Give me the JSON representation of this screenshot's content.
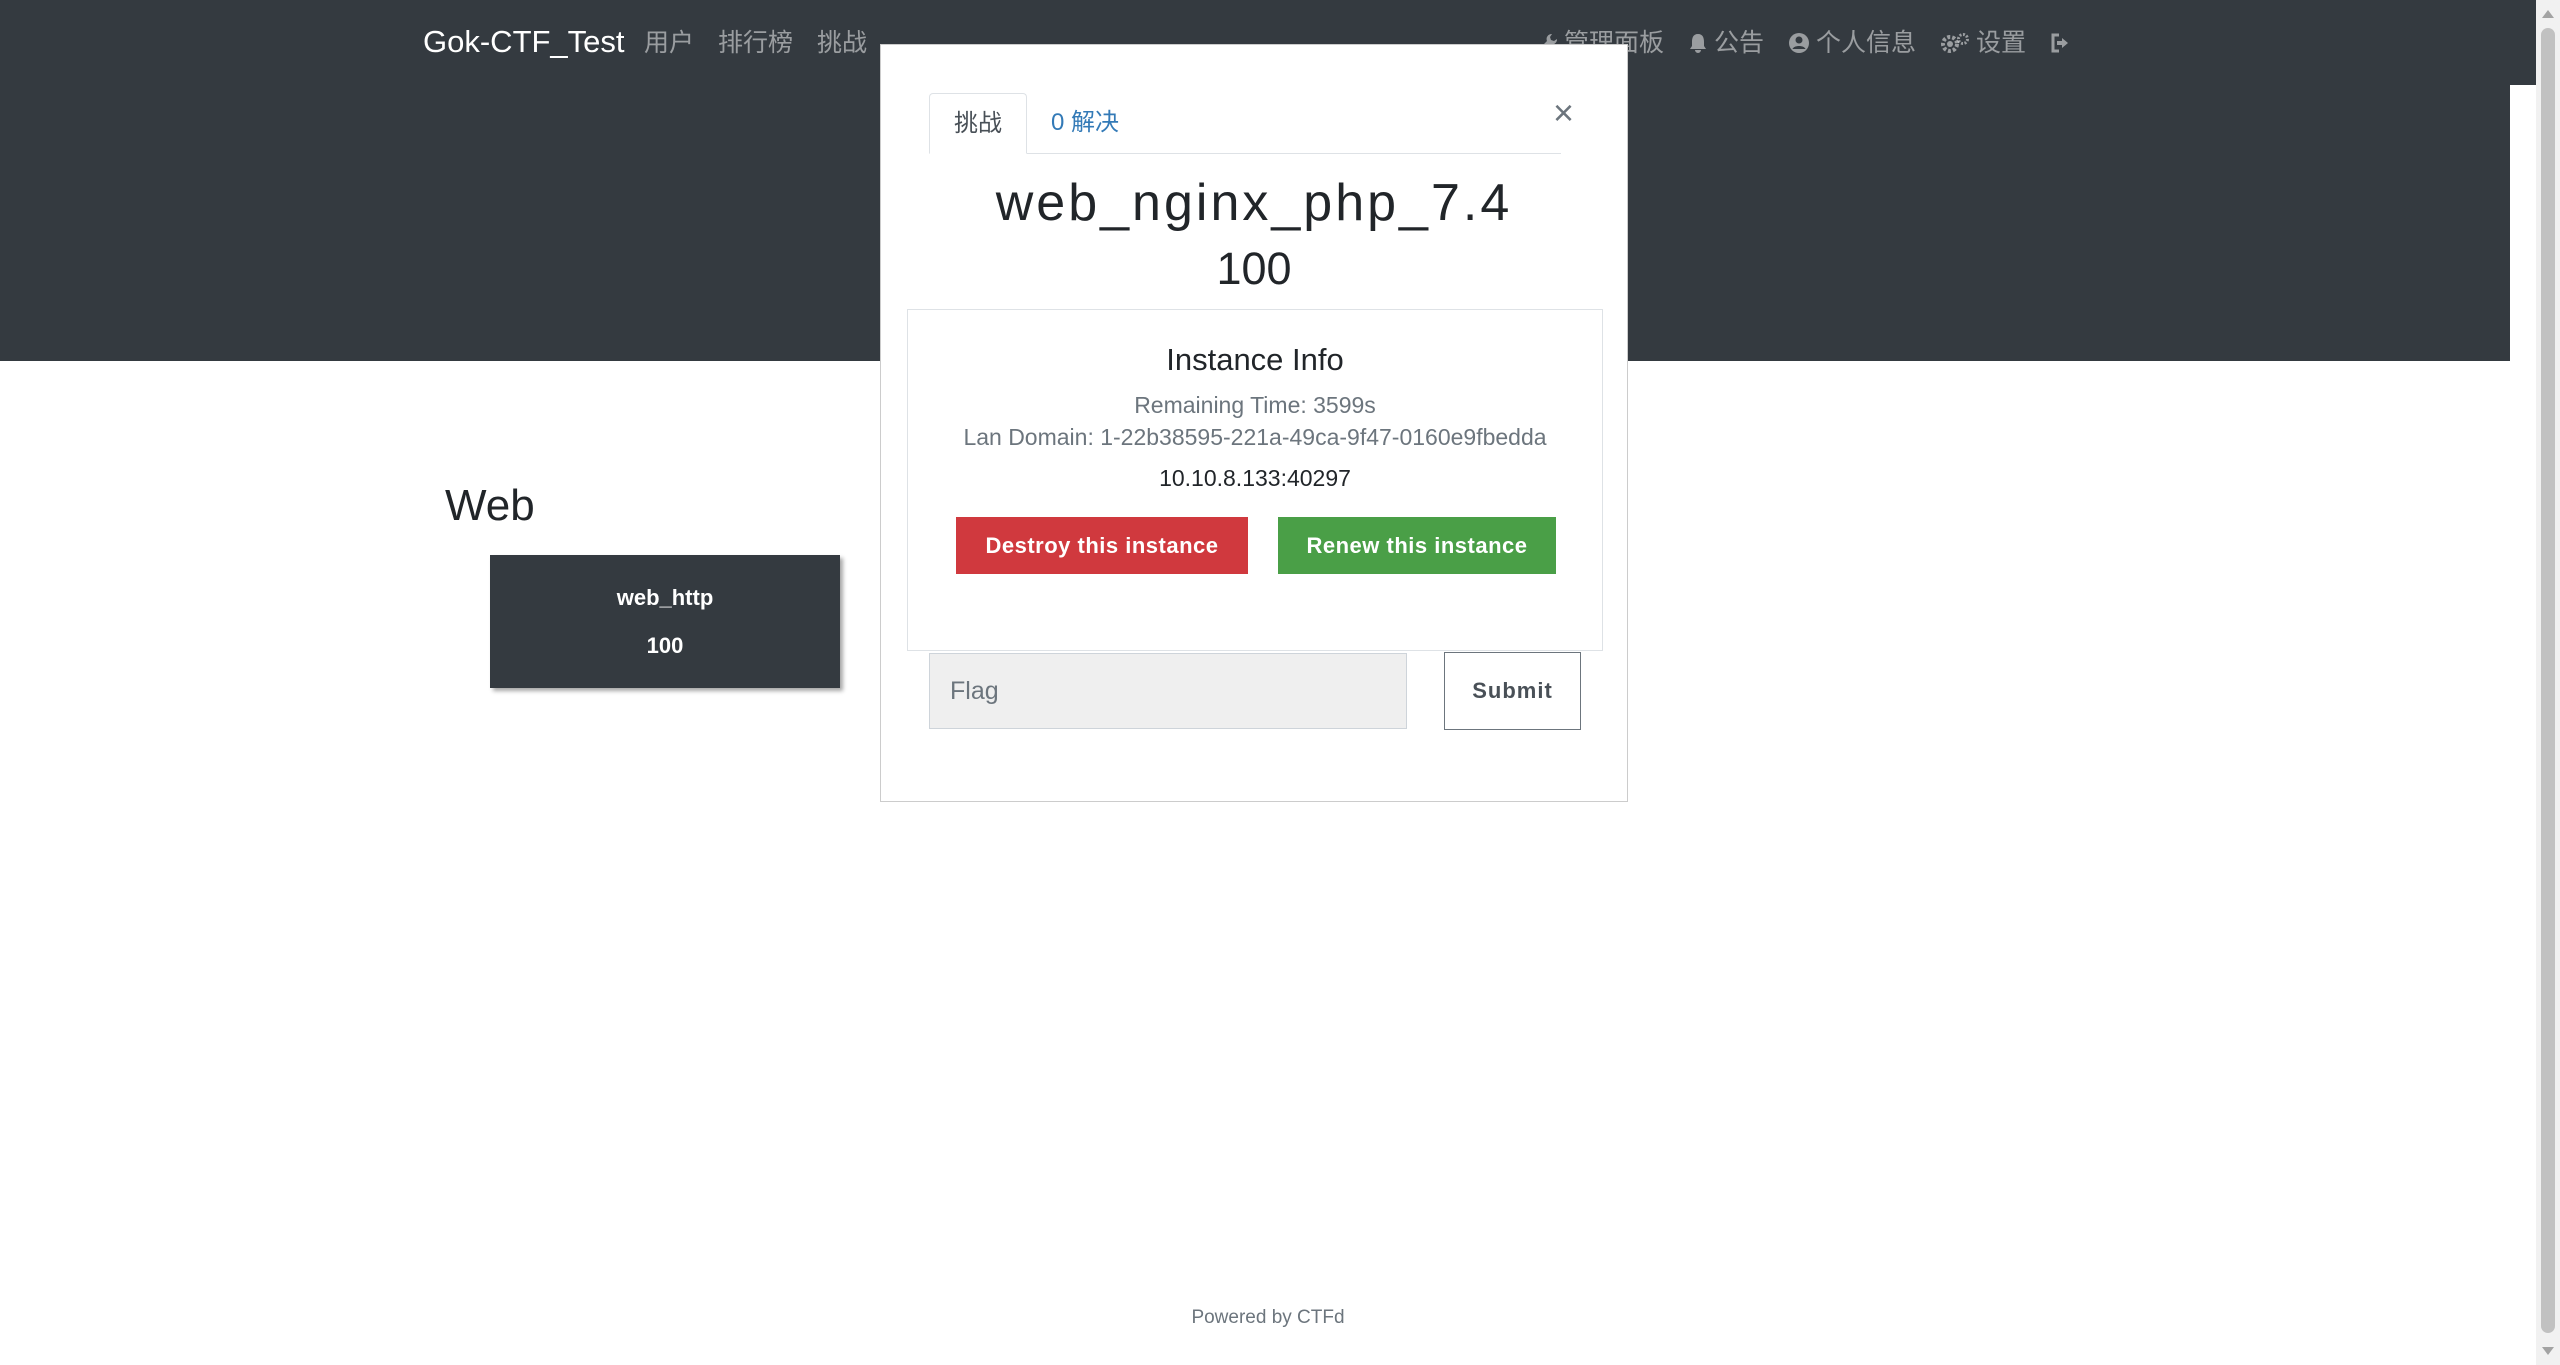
{
  "navbar": {
    "brand": "Gok-CTF_Test",
    "left_items": [
      "用户",
      "排行榜",
      "挑战"
    ],
    "right_items": [
      {
        "icon": "wrench-icon",
        "label": "管理面板"
      },
      {
        "icon": "bell-icon",
        "label": "公告"
      },
      {
        "icon": "user-circle-icon",
        "label": "个人信息"
      },
      {
        "icon": "cogs-icon",
        "label": "设置"
      },
      {
        "icon": "logout-icon",
        "label": ""
      }
    ]
  },
  "category": {
    "name": "Web",
    "challenges": [
      {
        "name": "web_http",
        "value": "100"
      }
    ]
  },
  "modal": {
    "tabs": [
      "挑战",
      "0 解决"
    ],
    "close": "×",
    "title": "web_nginx_php_7.4",
    "value": "100",
    "instance": {
      "title": "Instance Info",
      "remaining": "Remaining Time: 3599s",
      "domain": "Lan Domain: 1-22b38595-221a-49ca-9f47-0160e9fbedda",
      "address": "10.10.8.133:40297",
      "destroy_label": "Destroy this instance",
      "renew_label": "Renew this instance"
    },
    "flag_placeholder": "Flag",
    "submit_label": "Submit"
  },
  "footer": "Powered by CTFd",
  "colors": {
    "navbar_bg": "#343a40",
    "destroy": "#d0393e",
    "renew": "#4a9f47",
    "link": "#337ab7"
  }
}
